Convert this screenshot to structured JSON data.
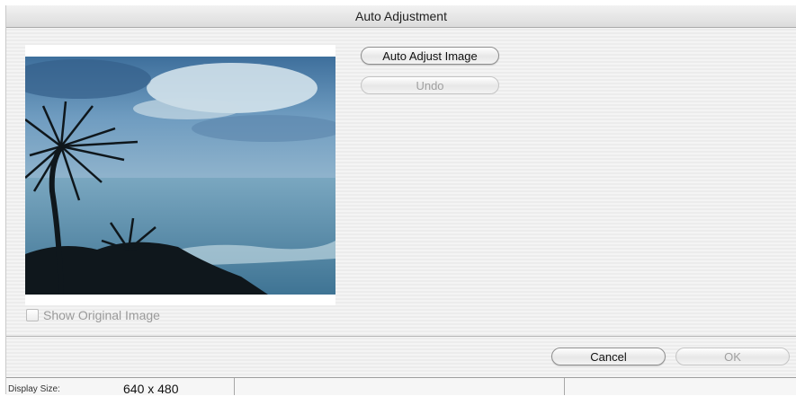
{
  "window": {
    "title": "Auto Adjustment"
  },
  "buttons": {
    "auto_adjust": "Auto Adjust Image",
    "undo": "Undo",
    "cancel": "Cancel",
    "ok": "OK"
  },
  "show_original": {
    "label": "Show Original Image",
    "checked": false
  },
  "status": {
    "display_size_label": "Display Size:",
    "display_size_value": "640 x 480"
  },
  "colors": {
    "sky": "#4f7ea8",
    "sea": "#6a9db8",
    "silhouette": "#111a20"
  }
}
